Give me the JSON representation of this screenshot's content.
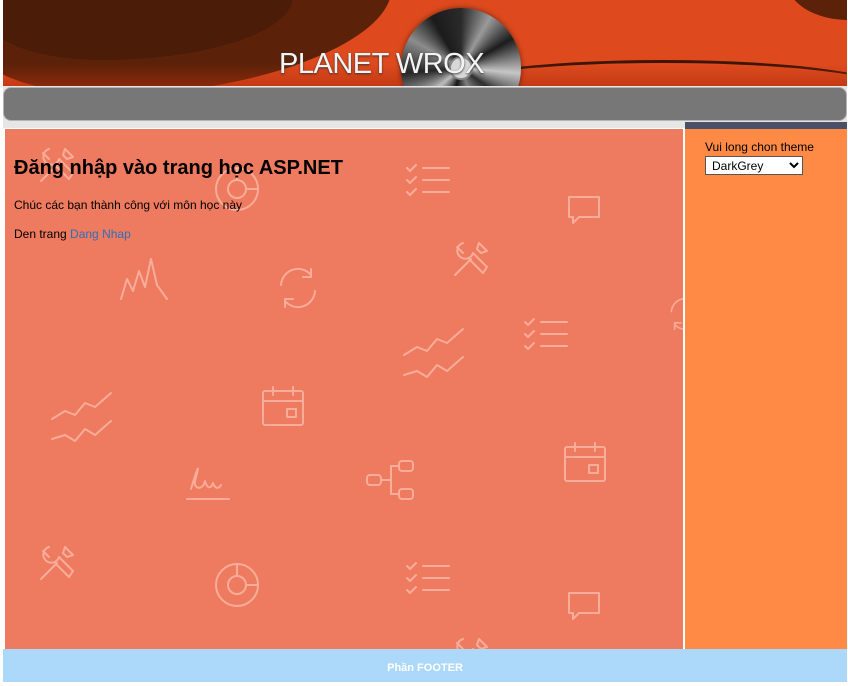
{
  "header": {
    "logo_text": "PLANET WROX",
    "colors": {
      "banner": "#de4a1e",
      "dark_blob": "#5c2209"
    },
    "artwork": "cd-disc-icon"
  },
  "menu": {
    "items": [],
    "color": "#777777"
  },
  "main": {
    "title": "Đăng nhập vào trang học ASP.NET",
    "welcome_text": "Chúc các bạn thành công với môn học này",
    "login_prefix": "Den trang ",
    "login_link_label": "Dang Nhap",
    "background_color": "#ee7a5f",
    "background_icons": [
      "tools-icon",
      "checklist-icon",
      "chat-bubble-icon",
      "refresh-icon",
      "line-chart-icon",
      "calendar-icon",
      "signature-icon",
      "share-nodes-icon",
      "pie-chart-icon",
      "mountain-chart-icon"
    ]
  },
  "sidebar": {
    "theme_label": "Vui long chon theme",
    "theme_selected": "DarkGrey",
    "background_color": "#fe8a46"
  },
  "footer": {
    "text": "Phần FOOTER",
    "background_color": "#acd8fa"
  }
}
